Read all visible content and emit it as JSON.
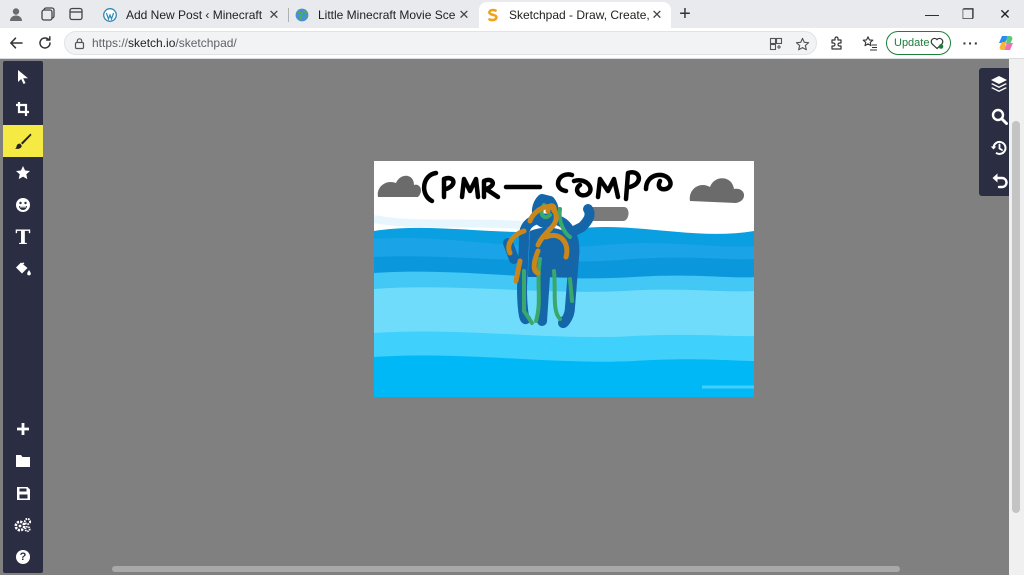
{
  "browser": {
    "tabs": [
      {
        "title": "Add New Post ‹ Minecraft Blog —",
        "active": false,
        "favicon": "wordpress-icon"
      },
      {
        "title": "Little Minecraft Movie Scene Scrip",
        "active": false,
        "favicon": "globe-icon"
      },
      {
        "title": "Sketchpad - Draw, Create, Share!",
        "active": true,
        "favicon": "sketchpad-icon"
      }
    ],
    "close_glyph": "✕",
    "new_tab_glyph": "+",
    "window": {
      "minimize": "—",
      "restore": "❐",
      "close": "✕"
    },
    "address": {
      "scheme": "https://",
      "host": "sketch.io",
      "path": "/sketchpad/"
    },
    "update_label": "Update",
    "more_glyph": "···"
  },
  "app": {
    "left_tools": [
      {
        "name": "select-tool",
        "icon": "cursor-icon"
      },
      {
        "name": "crop-tool",
        "icon": "crop-icon"
      },
      {
        "name": "brush-tool",
        "icon": "brush-icon",
        "active": true
      },
      {
        "name": "stamp-tool",
        "icon": "star-icon"
      },
      {
        "name": "emoji-tool",
        "icon": "emoji-icon"
      },
      {
        "name": "text-tool",
        "icon": "text-icon",
        "glyph": "T"
      },
      {
        "name": "fill-tool",
        "icon": "paint-bucket-icon"
      },
      {
        "name": "new-button",
        "icon": "plus-icon"
      },
      {
        "name": "open-button",
        "icon": "folder-icon"
      },
      {
        "name": "save-button",
        "icon": "floppy-disk-icon"
      },
      {
        "name": "settings-button",
        "icon": "gears-icon"
      },
      {
        "name": "help-button",
        "icon": "help-icon",
        "glyph": "?"
      }
    ],
    "right_tools": [
      {
        "name": "layers-button",
        "icon": "layers-icon"
      },
      {
        "name": "zoom-button",
        "icon": "magnifier-icon"
      },
      {
        "name": "history-button",
        "icon": "history-icon"
      },
      {
        "name": "undo-button",
        "icon": "undo-icon"
      }
    ],
    "accent_color": "#f5e943",
    "toolbar_color": "#2b2d42",
    "workspace_color": "#808080"
  }
}
